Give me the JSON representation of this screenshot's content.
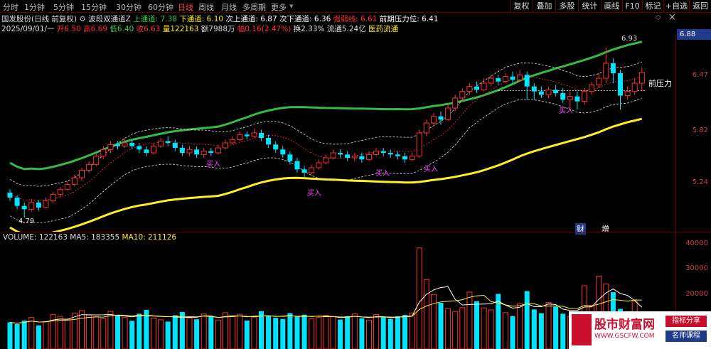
{
  "timeframe_tabs": [
    "分时",
    "1分钟",
    "5分钟",
    "15分钟",
    "30分钟",
    "60分钟",
    "日线",
    "周线",
    "月线",
    "多周期",
    "更多"
  ],
  "active_tab": "日线",
  "right_buttons": [
    "复权",
    "叠加",
    "多股",
    "统计",
    "画线",
    "F10",
    "标记",
    "+自选",
    "返回"
  ],
  "indicator_line": {
    "stock": "国发股份(日线 前复权)",
    "indicator_name": "波段双通道Z",
    "upper_label": "上通道: 7.38",
    "lower_label": "下通道: 6.10",
    "sub_upper_label": "次上通道: 6.87",
    "sub_lower_label": "次下通道: 6.36",
    "strength_label": "强弱线: 6.61",
    "pressure_label": "前期压力位: 6.41"
  },
  "quote_line": {
    "date": "2025/09/01/一",
    "open": "开6.50",
    "high": "高6.69",
    "low": "低6.40",
    "close": "收6.63",
    "volume": "量122163",
    "amount": "额7988万",
    "change": "幅0.16(2.47%)",
    "turnover": "换2.33%",
    "float": "流通5.24亿",
    "sector": "医药流通"
  },
  "price_axis": [
    "6.47",
    "5.82",
    "5.24"
  ],
  "current_price": "6.88",
  "annotations": {
    "high_label": "6.93",
    "low_label": "4.79",
    "pressure_text": "前压力",
    "buy_signal": "买入",
    "fin_marker": "财",
    "inc_marker": "增"
  },
  "volume_info": {
    "volume": "VOLUME: 122163",
    "ma5": "MA5: 183355",
    "ma10": "MA10: 211126"
  },
  "volume_axis": [
    "40000",
    "30000",
    "20000"
  ],
  "watermark": {
    "brand": "股市财富网",
    "url": "WWW.GSCFW.COM",
    "tag1": "指标分享",
    "tag2": "名师课程"
  },
  "colors": {
    "up": "#ff3030",
    "down": "#00e5ff",
    "green_line": "#33bb44",
    "yellow_line": "#ffee22",
    "volume_yellow": "#ffee22"
  },
  "candles": [
    [
      5.18,
      5.12,
      5.22,
      5.08
    ],
    [
      5.12,
      5.02,
      5.15,
      4.98
    ],
    [
      5.02,
      4.98,
      5.06,
      4.88
    ],
    [
      4.98,
      5.06,
      5.1,
      4.95
    ],
    [
      5.06,
      5.0,
      5.09,
      4.96
    ],
    [
      5.0,
      5.08,
      5.12,
      4.99
    ],
    [
      5.08,
      5.16,
      5.19,
      5.05
    ],
    [
      5.16,
      5.22,
      5.25,
      5.12
    ],
    [
      5.22,
      5.28,
      5.32,
      5.2
    ],
    [
      5.28,
      5.36,
      5.4,
      5.25
    ],
    [
      5.36,
      5.45,
      5.48,
      5.32
    ],
    [
      5.45,
      5.52,
      5.56,
      5.42
    ],
    [
      5.52,
      5.62,
      5.66,
      5.5
    ],
    [
      5.62,
      5.7,
      5.74,
      5.58
    ],
    [
      5.7,
      5.76,
      5.8,
      5.66
    ],
    [
      5.76,
      5.74,
      5.8,
      5.7
    ],
    [
      5.74,
      5.78,
      5.83,
      5.72
    ],
    [
      5.78,
      5.74,
      5.82,
      5.7
    ],
    [
      5.74,
      5.7,
      5.78,
      5.66
    ],
    [
      5.7,
      5.66,
      5.74,
      5.62
    ],
    [
      5.66,
      5.74,
      5.78,
      5.64
    ],
    [
      5.74,
      5.8,
      5.84,
      5.72
    ],
    [
      5.8,
      5.78,
      5.86,
      5.74
    ],
    [
      5.78,
      5.72,
      5.82,
      5.68
    ],
    [
      5.72,
      5.66,
      5.76,
      5.62
    ],
    [
      5.66,
      5.7,
      5.74,
      5.62
    ],
    [
      5.7,
      5.64,
      5.74,
      5.6
    ],
    [
      5.64,
      5.68,
      5.72,
      5.6
    ],
    [
      5.68,
      5.66,
      5.72,
      5.62
    ],
    [
      5.66,
      5.72,
      5.76,
      5.64
    ],
    [
      5.72,
      5.78,
      5.82,
      5.7
    ],
    [
      5.78,
      5.82,
      5.86,
      5.76
    ],
    [
      5.82,
      5.88,
      5.92,
      5.8
    ],
    [
      5.88,
      5.86,
      5.92,
      5.82
    ],
    [
      5.86,
      5.9,
      5.95,
      5.84
    ],
    [
      5.9,
      5.84,
      5.94,
      5.8
    ],
    [
      5.84,
      5.76,
      5.88,
      5.72
    ],
    [
      5.76,
      5.7,
      5.8,
      5.66
    ],
    [
      5.7,
      5.64,
      5.74,
      5.6
    ],
    [
      5.64,
      5.56,
      5.68,
      5.52
    ],
    [
      5.56,
      5.46,
      5.6,
      5.42
    ],
    [
      5.46,
      5.42,
      5.5,
      5.36
    ],
    [
      5.42,
      5.48,
      5.52,
      5.4
    ],
    [
      5.48,
      5.54,
      5.58,
      5.46
    ],
    [
      5.54,
      5.6,
      5.64,
      5.52
    ],
    [
      5.6,
      5.66,
      5.7,
      5.58
    ],
    [
      5.66,
      5.64,
      5.7,
      5.6
    ],
    [
      5.64,
      5.6,
      5.68,
      5.56
    ],
    [
      5.6,
      5.62,
      5.66,
      5.56
    ],
    [
      5.62,
      5.58,
      5.66,
      5.54
    ],
    [
      5.58,
      5.64,
      5.68,
      5.56
    ],
    [
      5.64,
      5.68,
      5.72,
      5.62
    ],
    [
      5.68,
      5.66,
      5.72,
      5.62
    ],
    [
      5.66,
      5.64,
      5.7,
      5.6
    ],
    [
      5.64,
      5.62,
      5.68,
      5.58
    ],
    [
      5.62,
      5.58,
      5.66,
      5.54
    ],
    [
      5.58,
      5.62,
      5.66,
      5.56
    ],
    [
      5.62,
      5.9,
      5.94,
      5.6
    ],
    [
      5.9,
      6.02,
      6.06,
      5.86
    ],
    [
      6.02,
      6.1,
      6.14,
      5.98
    ],
    [
      6.1,
      6.06,
      6.16,
      6.0
    ],
    [
      6.06,
      6.2,
      6.24,
      6.04
    ],
    [
      6.2,
      6.32,
      6.36,
      6.16
    ],
    [
      6.32,
      6.4,
      6.44,
      6.28
    ],
    [
      6.4,
      6.46,
      6.5,
      6.36
    ],
    [
      6.46,
      6.42,
      6.52,
      6.38
    ],
    [
      6.42,
      6.5,
      6.56,
      6.4
    ],
    [
      6.5,
      6.56,
      6.6,
      6.46
    ],
    [
      6.56,
      6.52,
      6.6,
      6.48
    ],
    [
      6.52,
      6.58,
      6.62,
      6.5
    ],
    [
      6.58,
      6.54,
      6.64,
      6.5
    ],
    [
      6.54,
      6.6,
      6.66,
      6.52
    ],
    [
      6.6,
      6.46,
      6.64,
      6.3
    ],
    [
      6.46,
      6.4,
      6.5,
      6.3
    ],
    [
      6.4,
      6.36,
      6.46,
      6.32
    ],
    [
      6.36,
      6.42,
      6.46,
      6.32
    ],
    [
      6.42,
      6.38,
      6.48,
      6.34
    ],
    [
      6.38,
      6.3,
      6.44,
      6.26
    ],
    [
      6.3,
      6.34,
      6.4,
      6.2
    ],
    [
      6.34,
      6.28,
      6.4,
      6.18
    ],
    [
      6.28,
      6.4,
      6.44,
      6.24
    ],
    [
      6.4,
      6.48,
      6.52,
      6.36
    ],
    [
      6.48,
      6.56,
      6.62,
      6.44
    ],
    [
      6.56,
      6.74,
      6.93,
      6.5
    ],
    [
      6.74,
      6.62,
      6.8,
      6.5
    ],
    [
      6.62,
      6.35,
      6.66,
      6.18
    ],
    [
      6.35,
      6.4,
      6.46,
      6.3
    ],
    [
      6.4,
      6.5,
      6.56,
      6.36
    ],
    [
      6.5,
      6.63,
      6.69,
      6.4
    ]
  ],
  "volumes": [
    10500,
    9800,
    11200,
    12400,
    9300,
    10800,
    13600,
    12900,
    11800,
    14200,
    15100,
    13400,
    12700,
    11900,
    14800,
    13200,
    12400,
    11100,
    13900,
    15400,
    12200,
    11500,
    10800,
    13300,
    14600,
    12100,
    11700,
    13800,
    12900,
    11400,
    14300,
    12800,
    13700,
    11200,
    12600,
    14900,
    13100,
    12300,
    11800,
    14100,
    12700,
    13500,
    11900,
    12400,
    13200,
    12800,
    11600,
    12900,
    13800,
    12100,
    11400,
    13600,
    12700,
    11800,
    12900,
    13400,
    14200,
    39800,
    27400,
    21500,
    18200,
    15900,
    14800,
    16300,
    22400,
    18800,
    16200,
    15400,
    21700,
    14300,
    12900,
    17900,
    22800,
    15600,
    14100,
    18300,
    16700,
    13900,
    12800,
    14500,
    24900,
    16800,
    28700,
    25600,
    22400,
    15800,
    12900,
    18800,
    12216
  ]
}
